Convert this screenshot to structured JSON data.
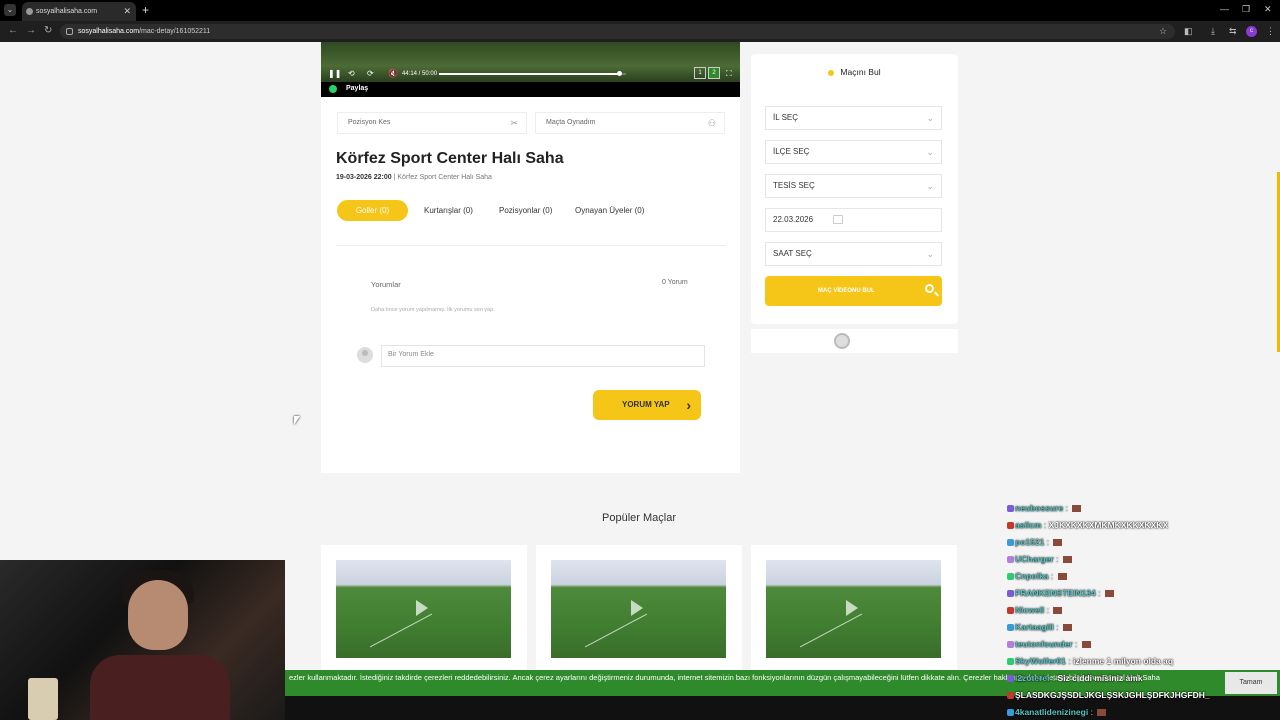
{
  "browser": {
    "tab_title": "sosyalhalisaha.com",
    "url_domain": "sosyalhalisaha.com",
    "url_path": "/mac-detay/161052211"
  },
  "video": {
    "time": "44:14 / 50:00",
    "progress": 0.97,
    "quality_1": "1",
    "quality_2": "2",
    "share_label": "Paylaş"
  },
  "actions": {
    "cut_label": "Pozisyon Kes",
    "played_label": "Maçta Oynadım"
  },
  "match": {
    "title": "Körfez Sport Center Halı Saha",
    "datetime": "19-03-2026 22:00",
    "separator": "|",
    "venue": "Körfez Sport Center Halı Saha"
  },
  "tabs": [
    {
      "label": "Goller (0)",
      "active": true
    },
    {
      "label": "Kurtarışlar (0)"
    },
    {
      "label": "Pozisyonlar (0)"
    },
    {
      "label": "Oynayan Üyeler (0)"
    }
  ],
  "comments": {
    "label": "Yorumlar",
    "count": "0 Yorum",
    "empty_text": "Daha önce yorum yapılmamış. İlk yorumu sen yap.",
    "placeholder": "Bir Yorum Ekle",
    "submit_label": "YORUM YAP"
  },
  "sidebar": {
    "title": "Maçını Bul",
    "city": "İL SEÇ",
    "district": "İLÇE SEÇ",
    "facility": "TESİS SEÇ",
    "date": "22.03.2026",
    "time": "SAAT SEÇ",
    "find_label": "MAÇ VİDEONU BUL"
  },
  "popular": {
    "title": "Popüler Maçlar"
  },
  "cookie": {
    "text": "ezler kullanmaktadır. İstediğiniz takdirde çerezleri reddedebilirsiniz. Ancak çerez ayarlarını değiştirmeniz durumunda, internet sitemizin bazı fonksiyonlarının düzgün çalışmayabileceğini lütfen dikkate alın. Çerezler hakkında daha detaylı bilgiye ve Sosyal Halı Saha",
    "ok_label": "Tamam"
  },
  "chat": [
    {
      "user": "neubossure",
      "msg": ""
    },
    {
      "user": "asilcm",
      "msg": "XJKXKXKXMKMKXKKXKXKX"
    },
    {
      "user": "po1521",
      "msg": ""
    },
    {
      "user": "UCharger",
      "msg": ""
    },
    {
      "user": "Cnpolka",
      "msg": ""
    },
    {
      "user": "FRANKENSTEIN134",
      "msg": ""
    },
    {
      "user": "Nicwell",
      "msg": ""
    },
    {
      "user": "Kartaagill",
      "msg": ""
    },
    {
      "user": "teutonfounder",
      "msg": ""
    },
    {
      "user": "SkyWolfer01",
      "msg": "izlenme 1 milyon olda aq"
    },
    {
      "user": "i2zoterer",
      "msg": "Siz ciddi misiniz amk"
    },
    {
      "user": "",
      "msg": "ŞLASDKGJŞSDLJKGLŞSKJGHLŞDFKJHGFDH_"
    },
    {
      "user": "4kanatlidenizinegi",
      "msg": ""
    }
  ],
  "colors": {
    "accent": "#f5c518",
    "cookie_bg": "#2f8a2b",
    "chat_user": "#59c3c3"
  }
}
